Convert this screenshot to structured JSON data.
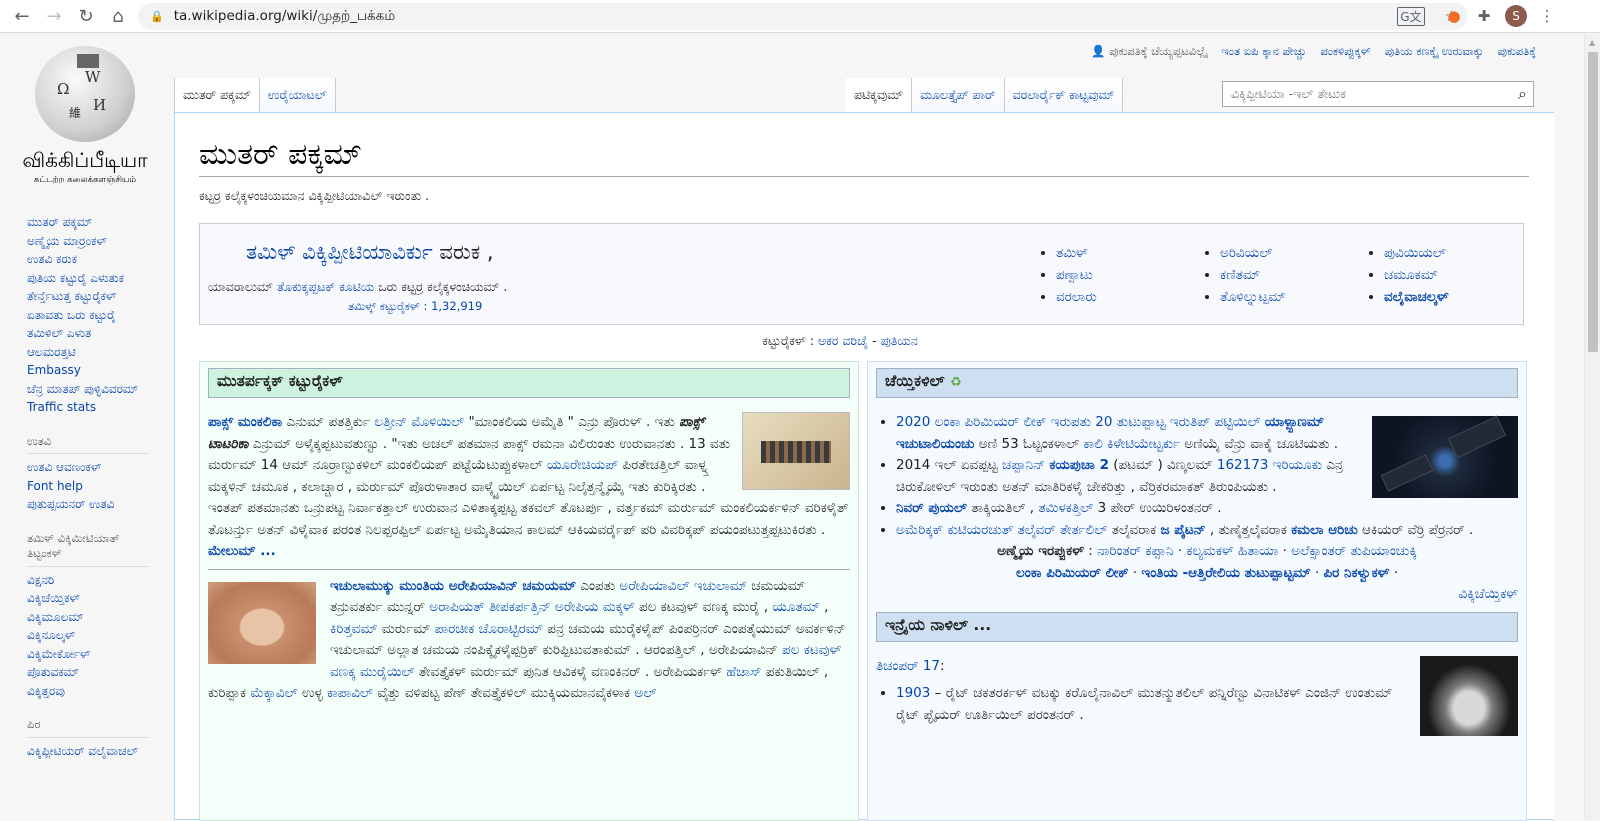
{
  "browser": {
    "url": "ta.wikipedia.org/wiki/முதற்_பக்கம்",
    "avatar_letter": "S"
  },
  "personal": {
    "not_logged_in": "ಪುಕುಪತಿಕ್ಕೆ ಚೆಯ್ಯಪ್ಪಟವಿಲ್ಲೈ",
    "ip_talk": "ಇಂತ ಐಪಿ ಕ್ಕಾನ ಪೇಚ್ಚು",
    "contributions": "ಪಂಕಳಿಪ್ಪುಕ್ಕಳ್",
    "create_account": "ಪುತಿಯ ಕಣಕ್ಕೈ ಉರುವಾಕ್ಕು",
    "login": "ಪುಕುಪತಿಕ್ಕೆ"
  },
  "logo": {
    "wordmark": "விக்கிப்பீடியா",
    "tagline": "கட்டற்ற கலைக்களஞ்சியம்"
  },
  "tabs": {
    "main_page": "ಮುತರ್ ಪಕ್ಕಮ್",
    "talk": "ಉರೈಯಾಟಲ್",
    "read": "ಪಟಿಕ್ಕವುಮ್",
    "view_source": "ಮೂಲತ್ತೈಪ್ ಪಾರ್",
    "history": "ವರಲಾರ್ರೈಕ್ ಕಾಟ್ಟವುಮ್"
  },
  "search": {
    "placeholder": "ವಿಕ್ಕಿಪ್ಪೀಟಿಯಾ -ಇಲ್ ತೇಟುಕ"
  },
  "sidebar": {
    "nav": [
      "ಮುತರ್ ಪಕ್ಕಮ್",
      "ಅಣ್ಮೈಯ ಮಾರ್ರಂಕಳ್",
      "ಉತವಿ ಕರುಕ",
      "ಪುತಿಯ ಕಟ್ಟುರೈ ಎಳುತುಕ",
      "ತೇರ್ನ್ತೆಟುತ್ತ ಕಟ್ಟುರೈಕಳ್",
      "ಏತಾವತು ಒರು ಕಟ್ಟುರೈ",
      "ತಮಿಳಿಲ್ ಎಳುತ",
      "ಆಲಮರತ್ತಟಿ",
      "Embassy",
      "ಚೆನ್ರ ಮಾತಪ್ ಪುಳ್ಳಿವಿವರಮ್",
      "Traffic stats"
    ],
    "help_heading": "ಉತವಿ",
    "help": [
      "ಉತವಿ ಆವಣಂಕಳ್",
      "Font help",
      "ಪುತುಪ್ಪಯನರ್ ಉತವಿ"
    ],
    "projects_heading": "ತಮಿಳ್ ವಿಕ್ಕಿಮೀಟಿಯಾತ್ ತಿಟ್ಟಂಕಳ್",
    "projects": [
      "ವಿಕ್ಷನರಿ",
      "ವಿಕ್ಕಿಚೆಯ್ತಿಕಳ್",
      "ವಿಕ್ಕಿಮೂಲಮ್",
      "ವಿಕ್ಕಿನೂಲ್ಕಳ್",
      "ವಿಕ್ಕಿಮೇರ್ಕೋಳ್",
      "ಪೊತುವಕಮ್",
      "ವಿಕ್ಕಿತ್ತರವು"
    ],
    "other_heading": "ಪಿರ",
    "other": [
      "ವಿಕ್ಕಿಪ್ಪೀಟಿಯರ್ ವಲೈವಾಚಲ್"
    ]
  },
  "page": {
    "title": "ಮುತರ್ ಪಕ್ಕಮ್",
    "subtitle": "ಕಟ್ಟರ್ರ ಕಲೈಕ್ಕಳಂಚಿಯಮಾನ ವಿಕ್ಕಿಪ್ಪೀಟಿಯಾವಿಲ್ ಇರುಂತು ."
  },
  "welcome": {
    "title_link": "ತಮಿಳ್ ವಿಕ್ಕಿಪ್ಪೀಟಿಯಾವಿರ್ಕು",
    "title_rest": " ವರುಕ ,",
    "line_pre": "ಯಾವರಾಲುಮ್ ",
    "line_link": "ತೊಕುಕ್ಕಪ್ಪಟಕ್ ಕೂಟಿಯ",
    "line_post": " ಒರು ಕಟ್ಟರ್ರ ಕಲೈಕ್ಕಳಂಚಿಯಮ್ .",
    "count_label": "ತಮಿಳ್ಕ್ ಕಟ್ಟುರೈಕಳ್ :",
    "count": "1,32,919",
    "portals": [
      [
        "ತಮಿಳ್",
        "ಪಣ್ಪಾಟು",
        "ವರಲಾರು"
      ],
      [
        "ಅರಿವಿಯಲ್",
        "ಕಣಿತಮ್",
        "ತೊಳಿಲ್ನುಟ್ಪಮ್"
      ],
      [
        "ಪುವಿಯಿಯಲ್",
        "ಚಮೂಕಮ್",
        "ವಲೈವಾಚಲ್ಕಳ್"
      ]
    ]
  },
  "articles": {
    "label": "ಕಟ್ಟುರೈಕಳ್ :",
    "alpha": "ಅಕರ ವರಿಚೈ",
    "sep": " - ",
    "new": "ಪುತಿಯನ"
  },
  "featured": {
    "heading": "ಮುತರ್ಪಕ್ಕಕ್ ಕಟ್ಟುರೈಕಳ್",
    "a1_link": "ಪಾಕ್ಸ್ ಮಂಕಲಿಕಾ",
    "a1_text1": " ಎನುಮ್ ಪತತ್ತಿರ್ಕು ",
    "a1_link2": "ಲತ್ತೀನ್ ಮೊಳಿಯಿಲ್",
    "a1_text2": " \"ಮಾಂಕಲಿಯ ಅಮೈತಿ \" ಎನ್ರು ಪೊರುಳ್ . ಇತು ",
    "a1_italic": "ಪಾಕ್ಸ್ ಟಾಟರಿಕಾ",
    "a1_text3": " ಎನ್ರುಮ್ ಅಳೈಕ್ಕಪ್ಪಟುವತುಣ್ಟು . \"ಇತು ಅಚಲ್ ಪತಮಾನ ಪಾಕ್ಸ್ ರಮನಾ ವಿಲಿರುಂತು ಉರುವಾನತು . 13 ವತು ಮರ್ರುಮ್ 14 ಆಮ್ ನೂರ್ರಾಣ್ಟುಕಳಿಲ್ ಮಂಕಲಿಯಪ್ ಪಟ್ಟೆಯೆಟುಪ್ಪುಕಳಾಲ್ ",
    "a1_link3": "ಯೂರೇಚಿಯಪ್",
    "a1_text4": " ಪಿರತೇಚತ್ತಿಲ್ ವಾಳ್ನ್ತ ಮಕ್ಕಳಿನ್ ಚಮೂಕ , ಕಲಾಚ್ಚಾರ , ಮರ್ರುಮ್ ಪೊರುಳಾತಾರ ವಾಳ್ಕ್ಕೈಯಿಲ್ ಏರ್ಪಟ್ಟ ನಿಲೈತ್ತನ್ಮೈಯೈ ಇತು ಕುರಿಕ್ಕಿರತು . ಇಂತಪ್ ಪತಮಾನತು ಒನ್ರುಪಟ್ಟ ನಿರ್ವಾಕತ್ತಾಲ್ ಉರುವಾನ ಎಳಿತಾಕ್ಕಪ್ಪಟ್ಟ ತಕವಲ್ ತೊಟರ್ಪು , ವರ್ತ್ತಕಮ್ ಮರ್ರುಮ್ ಮಂಕಲಿಯರ್ಕಳಿನ್ ವರಿಕಳೈತ್ ತೊಟರ್ನ್ತು ಅತನ್ ವಿಳೈವಾಕ ಪರಂತ ನಿಲಪ್ಪರಪ್ಪಿಲ್ ಏರ್ಪಟ್ಟ ಅಮೈತಿಯಾನ ಕಾಲಮ್ ಆಕಿಯವರ್ರೈಪ್ ಪರಿ ವಿವರಿಕ್ಕಪ್ ಪಯಂಪಟುತ್ತಪ್ಪಟುಕಿರತು . ",
    "a1_more": "ಮೇಲುಮ್ ...",
    "a2_link": "ಇಚುಲಾಮುಕ್ಕು ಮುಂತಿಯ ಅರೇಪಿಯಾವಿನ್ ಚಮಯಮ್",
    "a2_text1": " ಎಂಪತು ",
    "a2_link2": "ಅರೇಪಿಯಾವಿಲ್ ಇಚುಲಾಮ್",
    "a2_text2": " ಚಮಯಮ್ ತನ್ರುವತರ್ಕು ಮುನ್ನರ್ ",
    "a2_link3": "ಅರಾಪಿಯತ್ ತೀಪಕರ್ಪತ್ತಿನ್ ಅರೇಪಿಯ ಮಕ್ಕಳ್",
    "a2_text3": " ಪಲ ಕಟವುಳ್ ವಣಕ್ಕ ಮುರೈ , ",
    "a2_link4": "ಯೂತಮ್",
    "a2_text4": " , ",
    "a2_link5": "ಕಿರಿತ್ತವಮ್",
    "a2_text5": " ಮರ್ರುಮ್ ",
    "a2_link6": "ಪಾರಚೀಕ ಚೊರಾಟ್ಟಿರಮ್",
    "a2_text6": " ಪನ್ರ ಚಮಯ ಮುರೈಕಳೈಪ್ ಪಿಂಪರ್ರಿನರ್ ಎಂಪತೈಯುಮ್ ಅವರ್ಕಳಿನ್ ಇಚುಲಾಮ್ ಅಲ್ಲಾತ ಚಮಯ ನಂಪಿಕ್ಕೈಕಳೈಪ್ಪರ್ರಿಕ್ ಕುರಿಪ್ಪಿಟುವತಾಕುಮ್ . ಆರಂಪತ್ತಿಲ್ , ಅರೇಪಿಯಾವಿನ್ ",
    "a2_link7": "ಪಲ ಕಟವುಳ್ ವಣಕ್ಕ ಮುರೈಯಿಲ್",
    "a2_text7": " ತೇವತ್ತೈಕಳ್ ಮರ್ರುಮ್ ಪುನಿತ ಆವಿಕಳೈ ವಣಂಕಿನರ್ . ಅರೇಪಿಯರ್ಕಳ್ ",
    "a2_link8": "ಹೆಜಾಸ್",
    "a2_text8": " ಪಕುತಿಯಿಲ್ , ಕುರಿಪ್ಪಾಕ ",
    "a2_link9": "ಮೆಕ್ಕಾವಿಲ್",
    "a2_text9": " ಉಳ್ಳ ",
    "a2_link10": "ಕಾಪಾವಿಲ್",
    "a2_text10": " ವೈತ್ತು ವಳಿಪಟ್ಟ ಪೆಣ್ ತೇವತ್ತೈಕಳಿಲ್ ಮುಕ್ಕಿಯಮಾನವೈಕಳಾಕ ",
    "a2_link11": "ಅಲ್"
  },
  "news": {
    "heading": "ಚೆಯ್ತಿಕಳಿಲ್",
    "items": [
      {
        "segs": [
          {
            "t": "2020 ಲಂಕಾ ಪಿರಿಮಿಯರ್ ಲೀಕ್ ಇರುಪತು 20 ತುಟುಪ್ಪಾಟ್ಟ ಇರುತಿಪ್ ಪಟ್ಟಿಯಿಲ್ ",
            "l": 1
          },
          {
            "t": "ಯಾಳ್ಪ್ಪಾಣಮ್ ಇಚುಟಾಲಿಯಂಚು",
            "l": 2
          },
          {
            "t": " ಅಣಿ 53 ಓಟ್ಟಂಕಳಾಲ್ ",
            "l": 0
          },
          {
            "t": "ಕಾಲಿ ಕಿಳೇಟಿಯೇಟ್ಟರ್ಕು",
            "l": 1
          },
          {
            "t": " ಅಣಿಯೈ ವೆನ್ರು ವಾಕೈ ಚೂಟಿಯತು .",
            "l": 0
          }
        ]
      },
      {
        "segs": [
          {
            "t": "2014 ಇಲ್ ಏವಪ್ಪಟ್ಟ ",
            "l": 0
          },
          {
            "t": "ಚಪ್ಪಾನಿನ್",
            "l": 1
          },
          {
            "t": " ",
            "l": 0
          },
          {
            "t": "ಕಯಪುಚಾ 2",
            "l": 2
          },
          {
            "t": " (ಪಟಮ್ ) ವಿಣ್ಕಲಮ್ ",
            "l": 0
          },
          {
            "t": "162173 ಇರಿಯೂಕು",
            "l": 1
          },
          {
            "t": " ಎನ್ರ ಚಿರುಕೋಳಿಲ್ ಇರುಂತು ಅತನ್ ಮಾತಿರಿಕಳೈ ಚೇಕರಿತ್ತು , ವೆರ್ರಿಕರಮಾಕತ್ ತಿರುಂಪಿಯತು .",
            "l": 0
          }
        ]
      },
      {
        "segs": [
          {
            "t": "ನಿವರ್ ಪುಯಲ್",
            "l": 2
          },
          {
            "t": " ತಾಕ್ಕಿಯತಿಲ್ , ",
            "l": 0
          },
          {
            "t": "ತಮಿಳಕತ್ತಿಲ್",
            "l": 1
          },
          {
            "t": " 3 ಪೇರ್ ಉಯಿರಿಳಂತನರ್ .",
            "l": 0
          }
        ]
      },
      {
        "segs": [
          {
            "t": "ಅಮೆರಿಕ್ಕಕ್ ಕುಟಿಯರಚುತ್ ತಲೈವರ್ ತೇರ್ತಲಿಲ್",
            "l": 1
          },
          {
            "t": " ತಲೈವರಾಕ ",
            "l": 0
          },
          {
            "t": "ಜ ಪೈಟನ್",
            "l": 2
          },
          {
            "t": " , ತುಣೈತ್ತಲೈವರಾಕ ",
            "l": 0
          },
          {
            "t": "ಕಮಲಾ ಆರಿಚು",
            "l": 2
          },
          {
            "t": " ಆಕಿಯರ್ ವೆರ್ರಿ ಪೆರ್ರನರ್ .",
            "l": 0
          }
        ]
      }
    ],
    "recent_label": "ಅಣ್ಮೈಯ ಇರಪ್ಪುಕಳ್",
    "recent": [
      "ನಾರಿಂತರ್ ಕಪ್ಪಾನಿ",
      "ಕಲ್ಯಮಕಳ್ ಹಿತಾಯಾ",
      "ಅಲೆಕ್ಸಾಂತರ್ ತುಪಿಯಾಂಚುಕ್ಕಿ"
    ],
    "bold_links": [
      "ಲಂಕಾ ಪಿರಿಮಿಯರ್ ಲೀಕ್",
      "ಇಂತಿಯ -ಆತ್ತಿರೇಲಿಯ ತುಟುಪ್ಪಾಟ್ಟಮ್",
      "ಪಿರ ನಿಕಳ್ವುಕಳ್"
    ],
    "wikinews": "ವಿಕ್ಕಿಚೆಯ್ತಿಕಳ್"
  },
  "otd": {
    "heading": "ಇನ್ರೈಯ ನಾಳಿಲ್ ...",
    "date": "ತಿಚಂಪರ್ 17",
    "date_suffix": ":",
    "items": [
      {
        "year": "1903",
        "text": " – ರೈಟ್ ಚಕತರರ್ಕಳ್ ವಟಕ್ಕು ಕರೊಲೈನಾವಿಲ್ ಮುತನ್ಮುತಲಿಲ್ ಪನ್ನಿರೆಣ್ಟು ವಿನಾಟಿಕಳ್ ಎಂಜಿನ್ ಉಂತುಮ್ ರೈಟ್ ಪ್ಳೈಯರ್ ಊರ್ತಿಯಿಲ್ ಪರಂತನರ್ ."
      }
    ]
  }
}
